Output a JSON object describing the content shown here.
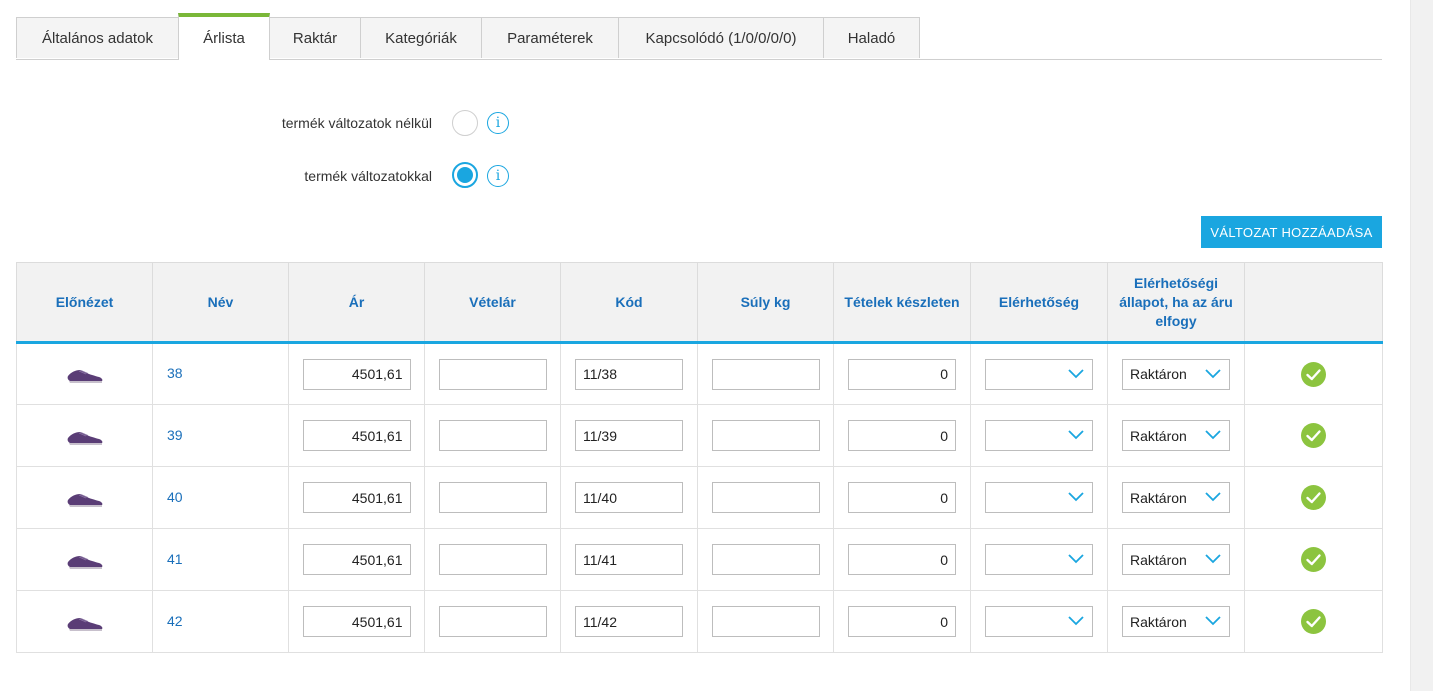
{
  "tabs": [
    {
      "label": "Általános adatok",
      "active": false
    },
    {
      "label": "Árlista",
      "active": true
    },
    {
      "label": "Raktár",
      "active": false
    },
    {
      "label": "Kategóriák",
      "active": false
    },
    {
      "label": "Paraméterek",
      "active": false
    },
    {
      "label": "Kapcsolódó (1/0/0/0/0)",
      "active": false
    },
    {
      "label": "Haladó",
      "active": false
    }
  ],
  "options": {
    "without_variants": {
      "label": "termék változatok nélkül",
      "checked": false
    },
    "with_variants": {
      "label": "termék változatokkal",
      "checked": true
    },
    "info_glyph": "i"
  },
  "add_variant_label": "VÁLTOZAT HOZZÁADÁSA",
  "table": {
    "headers": [
      "Előnézet",
      "Név",
      "Ár",
      "Vételár",
      "Kód",
      "Súly kg",
      "Tételek készleten",
      "Elérhetőség",
      "Elérhetőségi állapot, ha az áru elfogy",
      ""
    ],
    "rows": [
      {
        "name": "38",
        "price": "4501,61",
        "purchase_price": "",
        "code": "11/38",
        "weight": "",
        "stock": "0",
        "availability": "",
        "out_of_stock_status": "Raktáron"
      },
      {
        "name": "39",
        "price": "4501,61",
        "purchase_price": "",
        "code": "11/39",
        "weight": "",
        "stock": "0",
        "availability": "",
        "out_of_stock_status": "Raktáron"
      },
      {
        "name": "40",
        "price": "4501,61",
        "purchase_price": "",
        "code": "11/40",
        "weight": "",
        "stock": "0",
        "availability": "",
        "out_of_stock_status": "Raktáron"
      },
      {
        "name": "41",
        "price": "4501,61",
        "purchase_price": "",
        "code": "11/41",
        "weight": "",
        "stock": "0",
        "availability": "",
        "out_of_stock_status": "Raktáron"
      },
      {
        "name": "42",
        "price": "4501,61",
        "purchase_price": "",
        "code": "11/42",
        "weight": "",
        "stock": "0",
        "availability": "",
        "out_of_stock_status": "Raktáron"
      }
    ]
  },
  "icons": {
    "preview": "shoe-thumbnail",
    "status": "check-circle-icon",
    "dropdown": "chevron-down-icon",
    "info": "info-icon"
  },
  "colors": {
    "accent": "#1aa6e0",
    "active_tab": "#7ab738",
    "link": "#1a6fba",
    "ok": "#8cc43f"
  }
}
